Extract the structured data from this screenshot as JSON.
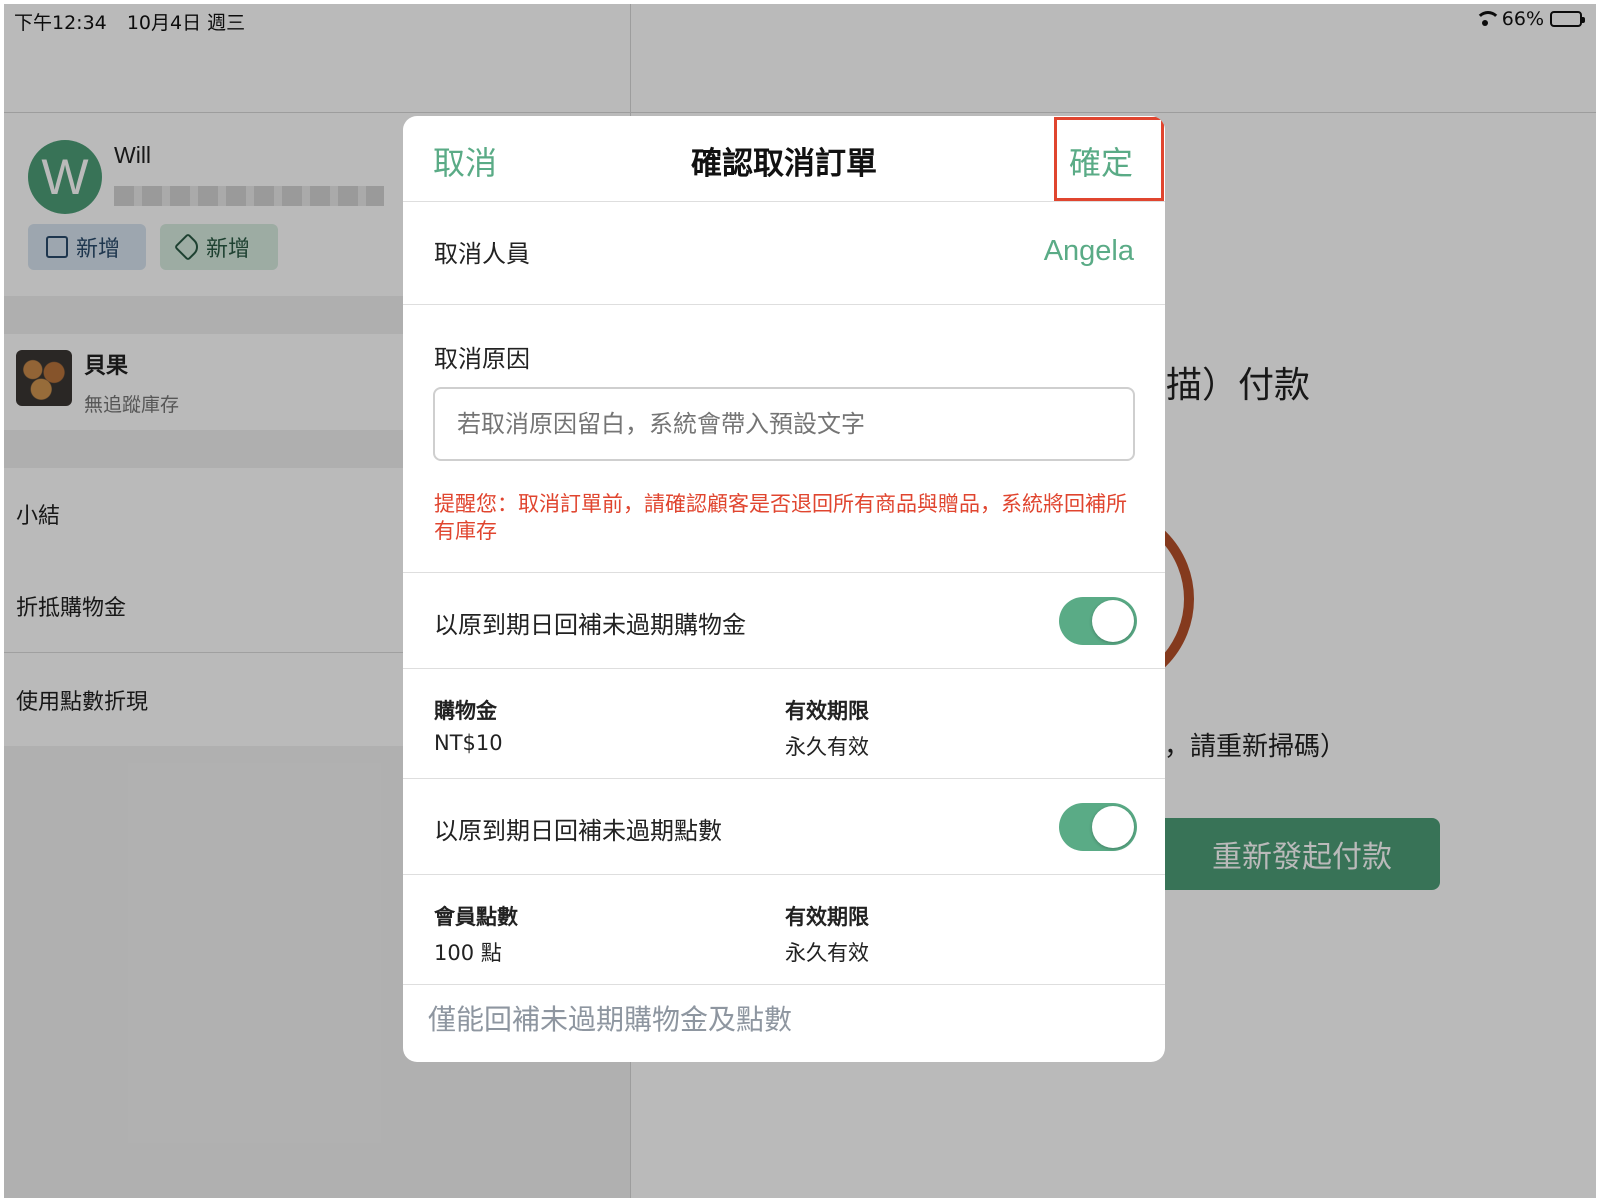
{
  "status_bar": {
    "time": "下午12:34",
    "date": "10月4日 週三",
    "battery": "66%",
    "battery_level": 0.66
  },
  "customer": {
    "avatar_letter": "W",
    "name": "Will",
    "note_button": "新增",
    "tag_button": "新增"
  },
  "order_item": {
    "name": "貝果",
    "stock_note": "無追蹤庫存"
  },
  "summary_rows": {
    "subtotal": "小結",
    "credit_discount": "折抵購物金",
    "points_discount": "使用點數折現"
  },
  "payment_panel": {
    "pay_text": "描）付款",
    "rescan_text": "，請重新掃碼）",
    "repay_button": "重新發起付款"
  },
  "modal": {
    "cancel_label": "取消",
    "title": "確認取消訂單",
    "confirm_label": "確定",
    "canceller_label": "取消人員",
    "canceller_value": "Angela",
    "reason_label": "取消原因",
    "reason_placeholder": "若取消原因留白，系統會帶入預設文字",
    "reason_value": "",
    "warning": "提醒您：取消訂單前，請確認顧客是否退回所有商品與贈品，系統將回補所有庫存",
    "restore_credit_label": "以原到期日回補未過期購物金",
    "restore_credit_on": true,
    "credit_label": "購物金",
    "credit_value": "NT$10",
    "credit_expiry_label": "有效期限",
    "credit_expiry_value": "永久有效",
    "restore_points_label": "以原到期日回補未過期點數",
    "restore_points_on": true,
    "points_label": "會員點數",
    "points_value": "100 點",
    "points_expiry_label": "有效期限",
    "points_expiry_value": "永久有效",
    "footer_note": "僅能回補未過期購物金及點數"
  },
  "colors": {
    "accent_green": "#5aab86",
    "warning_red": "#e0452f",
    "avatar_green": "#4e9e78"
  }
}
